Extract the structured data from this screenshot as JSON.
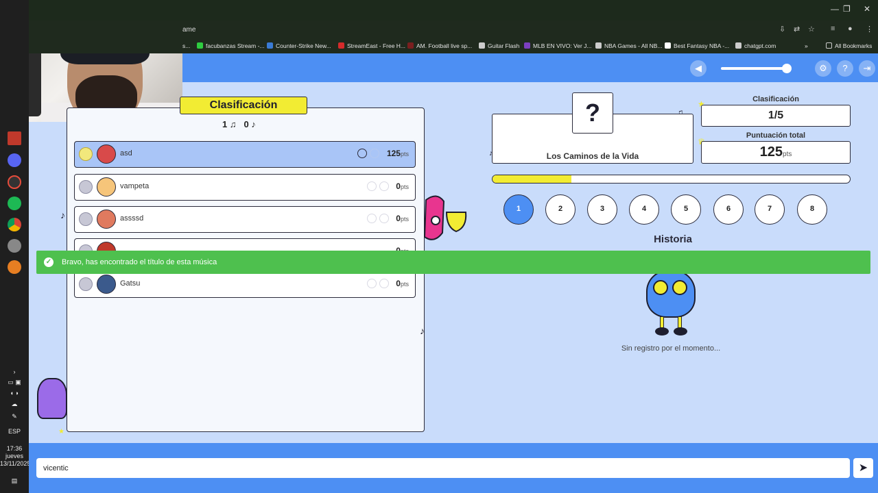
{
  "browser": {
    "tab_fragment": "ame",
    "bookmarks": [
      {
        "label": "s...",
        "color": "#888888"
      },
      {
        "label": "facubanzas Stream -...",
        "color": "#2ecc40"
      },
      {
        "label": "Counter-Strike New...",
        "color": "#3a7bd5"
      },
      {
        "label": "StreamEast - Free H...",
        "color": "#d52b2b"
      },
      {
        "label": "AM. Football live sp...",
        "color": "#7a1f1f"
      },
      {
        "label": "Guitar Flash",
        "color": "#cccccc"
      },
      {
        "label": "MLB EN VIVO: Ver J...",
        "color": "#7b3fbf"
      },
      {
        "label": "NBA Games - All NB...",
        "color": "#cccccc"
      },
      {
        "label": "Best Fantasy NBA -...",
        "color": "#ffffff"
      },
      {
        "label": "chatgpt.com",
        "color": "#cccccc"
      }
    ],
    "all_bookmarks": "All Bookmarks"
  },
  "taskbar": {
    "lang": "ESP",
    "time": "17:36",
    "day": "jueves",
    "date": "13/11/2025"
  },
  "header": {
    "volume_level": 0.9,
    "icons": [
      "volume-icon",
      "settings-icon",
      "help-icon",
      "exit-icon"
    ]
  },
  "leaderboard": {
    "title": "Clasificación",
    "found_title_count": "1",
    "found_artist_count": "0",
    "players": [
      {
        "name": "asd",
        "points": "125",
        "unit": "pts",
        "active": true,
        "avatar_color": "#d84a4a"
      },
      {
        "name": "vampeta",
        "points": "0",
        "unit": "pts",
        "active": false,
        "avatar_color": "#f6c57a"
      },
      {
        "name": "assssd",
        "points": "0",
        "unit": "pts",
        "active": false,
        "avatar_color": "#e07a5f"
      },
      {
        "name": "",
        "points": "0",
        "unit": "pts",
        "active": false,
        "avatar_color": "#c0392b"
      },
      {
        "name": "Gatsu",
        "points": "0",
        "unit": "pts",
        "active": false,
        "avatar_color": "#3b5a8c"
      }
    ]
  },
  "song": {
    "hidden_mark": "?",
    "title": "Los Caminos de la Vida"
  },
  "stats": {
    "rank_label": "Clasificación",
    "rank_value": "1/5",
    "total_label": "Puntuación total",
    "total_value": "125",
    "total_unit": "pts"
  },
  "progress": {
    "fraction": 0.22
  },
  "rounds": [
    "1",
    "2",
    "3",
    "4",
    "5",
    "6",
    "7",
    "8"
  ],
  "current_round": 0,
  "history": {
    "title": "Historia",
    "empty_text": "Sin registro por el momento..."
  },
  "toast": {
    "message": "Bravo, has encontrado el título de esta música"
  },
  "chat": {
    "value": "vicentic"
  },
  "colors": {
    "accent": "#4d8ff3",
    "highlight": "#f2ec33",
    "success": "#4ec04e"
  }
}
